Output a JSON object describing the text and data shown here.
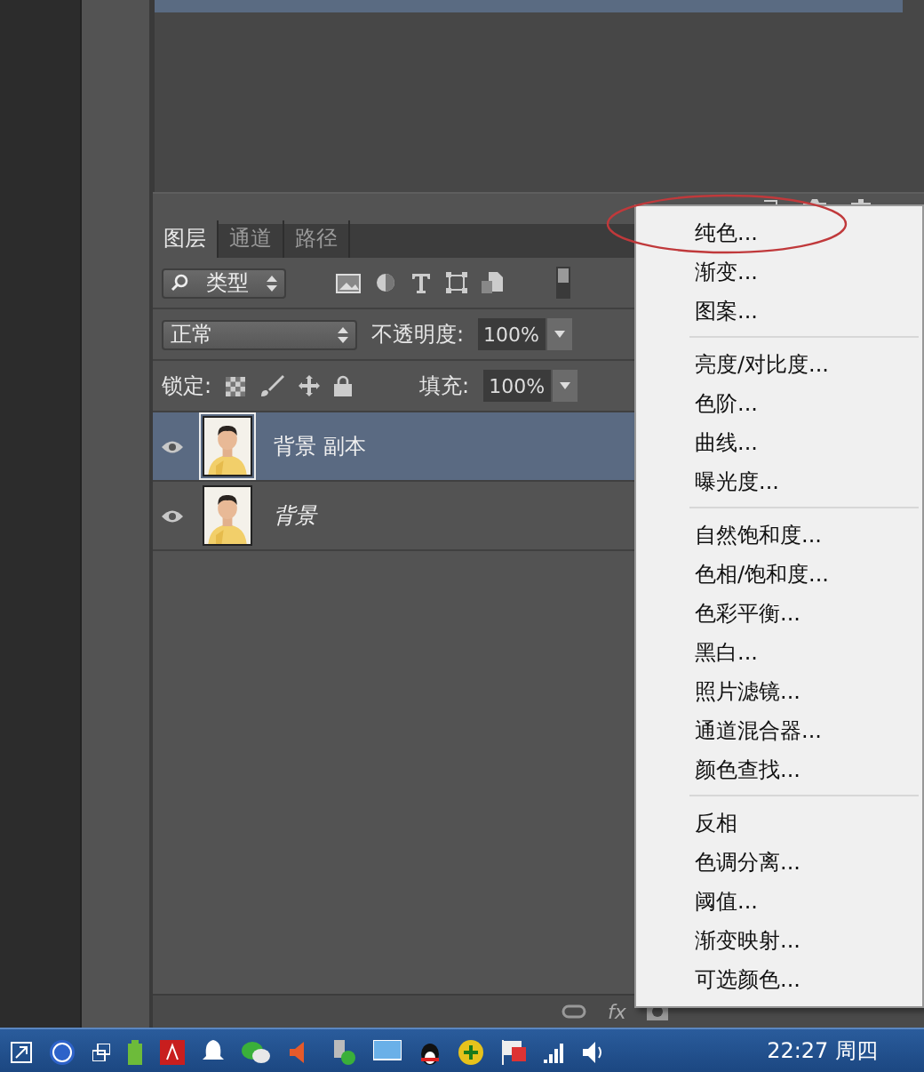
{
  "layers_panel": {
    "tabs": [
      {
        "label": "图层",
        "selected": true
      },
      {
        "label": "通道",
        "selected": false
      },
      {
        "label": "路径",
        "selected": false
      }
    ],
    "filter": {
      "value": "类型",
      "on": true
    },
    "footer": {
      "fx": "fx"
    },
    "blend_mode": {
      "value": "正常"
    },
    "opacity": {
      "label": "不透明度:",
      "value": "100%"
    },
    "lock": {
      "label": "锁定:"
    },
    "fill": {
      "label": "填充:",
      "value": "100%"
    },
    "layers": [
      {
        "name": "背景 副本",
        "kind": "normal",
        "selected": true,
        "visible": true
      },
      {
        "name": "背景",
        "kind": "background",
        "selected": false,
        "visible": true
      }
    ]
  },
  "menu": {
    "groups": [
      [
        "纯色...",
        "渐变...",
        "图案..."
      ],
      [
        "亮度/对比度...",
        "色阶...",
        "曲线...",
        "曝光度..."
      ],
      [
        "自然饱和度...",
        "色相/饱和度...",
        "色彩平衡...",
        "黑白...",
        "照片滤镜...",
        "通道混合器...",
        "颜色查找..."
      ],
      [
        "反相",
        "色调分离...",
        "阈值...",
        "渐变映射...",
        "可选颜色..."
      ]
    ]
  },
  "taskbar": {
    "clock": "22:27 周四"
  }
}
